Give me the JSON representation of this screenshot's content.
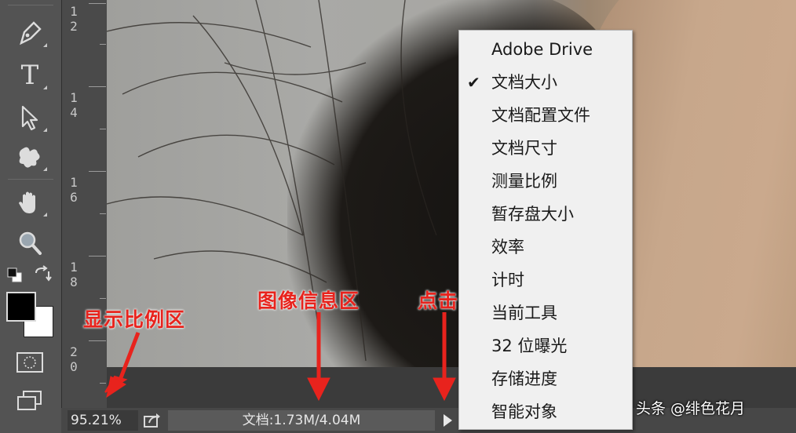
{
  "toolbar": {
    "tools": [
      {
        "name": "pen-tool-icon"
      },
      {
        "name": "type-tool-icon",
        "glyph": "T"
      },
      {
        "name": "path-selection-tool-icon"
      },
      {
        "name": "custom-shape-tool-icon"
      },
      {
        "name": "hand-tool-icon"
      },
      {
        "name": "zoom-tool-icon"
      }
    ]
  },
  "ruler": {
    "labels": [
      [
        "1",
        "2"
      ],
      [
        "1",
        "4"
      ],
      [
        "1",
        "6"
      ],
      [
        "1",
        "8"
      ],
      [
        "2",
        "0"
      ]
    ]
  },
  "menu": {
    "items": [
      {
        "label": "Adobe Drive",
        "checked": false
      },
      {
        "label": "文档大小",
        "checked": true
      },
      {
        "label": "文档配置文件",
        "checked": false
      },
      {
        "label": "文档尺寸",
        "checked": false
      },
      {
        "label": "测量比例",
        "checked": false
      },
      {
        "label": "暂存盘大小",
        "checked": false
      },
      {
        "label": "效率",
        "checked": false
      },
      {
        "label": "计时",
        "checked": false
      },
      {
        "label": "当前工具",
        "checked": false
      },
      {
        "label": "32 位曝光",
        "checked": false
      },
      {
        "label": "存储进度",
        "checked": false
      },
      {
        "label": "智能对象",
        "checked": false
      }
    ],
    "check_glyph": "✔"
  },
  "status": {
    "zoom": "95.21%",
    "doc_info": "文档:1.73M/4.04M"
  },
  "annotations": {
    "zoom_area": "显示比例区",
    "info_area": "图像信息区",
    "click": "点击"
  },
  "watermark": "头条 @绯色花月",
  "colors": {
    "annotation_red": "#e8231d",
    "menu_bg": "#f0f0f0",
    "toolbar_bg": "#535353"
  }
}
